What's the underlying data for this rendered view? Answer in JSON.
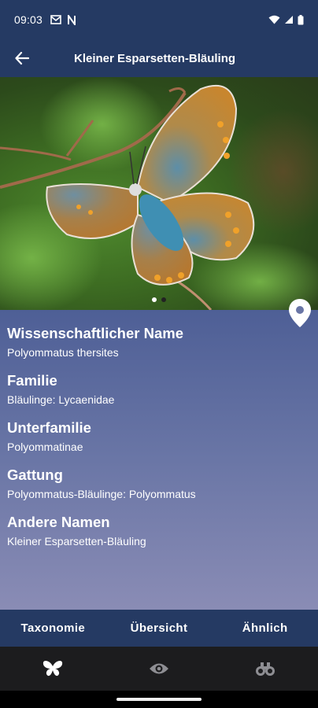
{
  "status_bar": {
    "time": "09:03",
    "notification_icons": [
      "mail-icon",
      "n-app-icon"
    ],
    "system_icons": [
      "wifi-icon",
      "signal-icon",
      "battery-icon"
    ]
  },
  "app_bar": {
    "title": "Kleiner Esparsetten-Bläuling",
    "back_icon": "arrow-left-icon"
  },
  "gallery": {
    "page_count": 2,
    "current_page": 1
  },
  "details": {
    "fields": [
      {
        "label": "Wissenschaftlicher Name",
        "value": "Polyommatus thersites"
      },
      {
        "label": "Familie",
        "value": "Bläulinge: Lycaenidae"
      },
      {
        "label": "Unterfamilie",
        "value": "Polyommatinae"
      },
      {
        "label": "Gattung",
        "value": "Polyommatus-Bläulinge: Polyommatus"
      },
      {
        "label": "Andere Namen",
        "value": "Kleiner Esparsetten-Bläuling"
      }
    ],
    "map_pin_icon": "location-pin-icon"
  },
  "tabs": [
    {
      "label": "Taxonomie"
    },
    {
      "label": "Übersicht"
    },
    {
      "label": "Ähnlich"
    }
  ],
  "bottom_nav": [
    {
      "icon": "butterfly-icon"
    },
    {
      "icon": "eye-icon"
    },
    {
      "icon": "binoculars-icon"
    }
  ],
  "colors": {
    "primary": "#253a63",
    "details_top": "#4e5f96",
    "details_bottom": "#8a8cb5",
    "nav_background": "#1c1c1e"
  }
}
